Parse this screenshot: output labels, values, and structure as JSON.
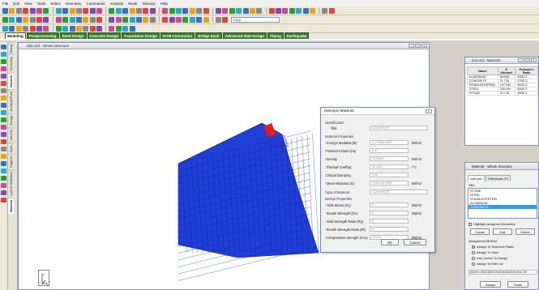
{
  "menubar": {
    "items": [
      "File",
      "Edit",
      "View",
      "Tools",
      "Select",
      "Geometry",
      "Commands",
      "Analysis",
      "Mode",
      "Window",
      "Help"
    ]
  },
  "toolbar": {
    "load_combo": "1:EQ"
  },
  "modebar": {
    "tabs": [
      "Modeling",
      "Postprocessing",
      "Steel Design",
      "Concrete Design",
      "Foundation Design",
      "RAM Connection",
      "Bridge Deck",
      "Advanced Slab Design",
      "Piping",
      "Earthquake"
    ],
    "active": 0
  },
  "pagecontrol": {
    "tabs": [
      "Setup",
      "Geometry",
      "General",
      "Analysis/Print",
      "Design"
    ],
    "subtabs": [
      "Job Info",
      "Spec",
      "Support",
      "Load & Definition",
      "Material"
    ]
  },
  "main_window": {
    "title": "dam.std - Whole Structure"
  },
  "structure": {
    "labels": [
      "CONCRETE",
      "CONCRETE",
      "CONCRETE",
      "CONCRETE"
    ],
    "fill_color": "#1f3fd6",
    "label_color": "#e02020"
  },
  "dialog": {
    "title": "Isotropic Material",
    "identification_label": "Identification",
    "title_label": "Title",
    "title_value": "CONCRETE",
    "material_properties_label": "Material Properties",
    "rows": [
      {
        "label": "Young's Modulus (E)",
        "value": "2.17185e+007",
        "unit": "kN/m2"
      },
      {
        "label": "Poisson's Ratio (nu)",
        "value": "0.17",
        "unit": ""
      },
      {
        "label": "Density",
        "value": "23.5616",
        "unit": "kN/m3"
      },
      {
        "label": "Thermal Coeff(a)",
        "value": "1e-005",
        "unit": "/°C"
      },
      {
        "label": "Critical Damping",
        "value": "0.05",
        "unit": ""
      },
      {
        "label": "Shear Modulus (G)",
        "value": "9.28139e+006",
        "unit": "kN/m2"
      }
    ],
    "type_of_material_label": "Type of Material",
    "type_of_material_value": "CONCRETE",
    "design_properties_label": "Design Properties",
    "design_rows": [
      {
        "label": "Yield Stress (Fy)",
        "value": "0",
        "unit": "kN/m2"
      },
      {
        "label": "Tensile Strength (Fu)",
        "value": "0",
        "unit": "kN/m2"
      },
      {
        "label": "Yield Strength Ratio (Ry)",
        "value": "0",
        "unit": ""
      },
      {
        "label": "Tensile Strength Ratio (Rt)",
        "value": "0",
        "unit": ""
      },
      {
        "label": "Compressive strength (Fcu)",
        "value": "27579",
        "unit": "kN/m2"
      }
    ],
    "ok_label": "OK",
    "cancel_label": "Cancel"
  },
  "material_table": {
    "title": "dam.std - Materials",
    "headers": [
      "Name",
      "E kN/mm2",
      "Poisson's Ratio"
    ],
    "rows": [
      [
        "ALUMINUM",
        "68.948",
        "330E-3"
      ],
      [
        "CONCRETE",
        "21.718",
        "170E-3"
      ],
      [
        "STAINLESSSTEEL",
        "197.930",
        "300E-3"
      ],
      [
        "STEEL",
        "205.000",
        "300E-3"
      ],
      [
        "STONE",
        "21.718",
        "160E-3"
      ]
    ]
  },
  "material_panel": {
    "title": "Material - Whole Structure",
    "tabs": [
      "Isotropic",
      "Orthotropic 2D"
    ],
    "list_title": "Title",
    "list_items": [
      "STONE",
      "STEEL",
      "STAINLESSSTEEL",
      "ALUMINUM",
      "CONCRETE"
    ],
    "selected_index": 4,
    "highlight_label": "Highlight Assigned Geometry",
    "create_label": "Create",
    "edit_label": "Edit",
    "delete_label": "Delete",
    "assignment_method_label": "Assignment Method",
    "methods": [
      "Assign To Selected Plates",
      "Assign To View",
      "Use Cursor To Assign",
      "Assign To Edit List"
    ],
    "selected_method": 0,
    "edit_list_value": "8025 To 8033 8035 8036 8038 8040 8041 80",
    "assign_label": "Assign",
    "close_label": "Close"
  }
}
